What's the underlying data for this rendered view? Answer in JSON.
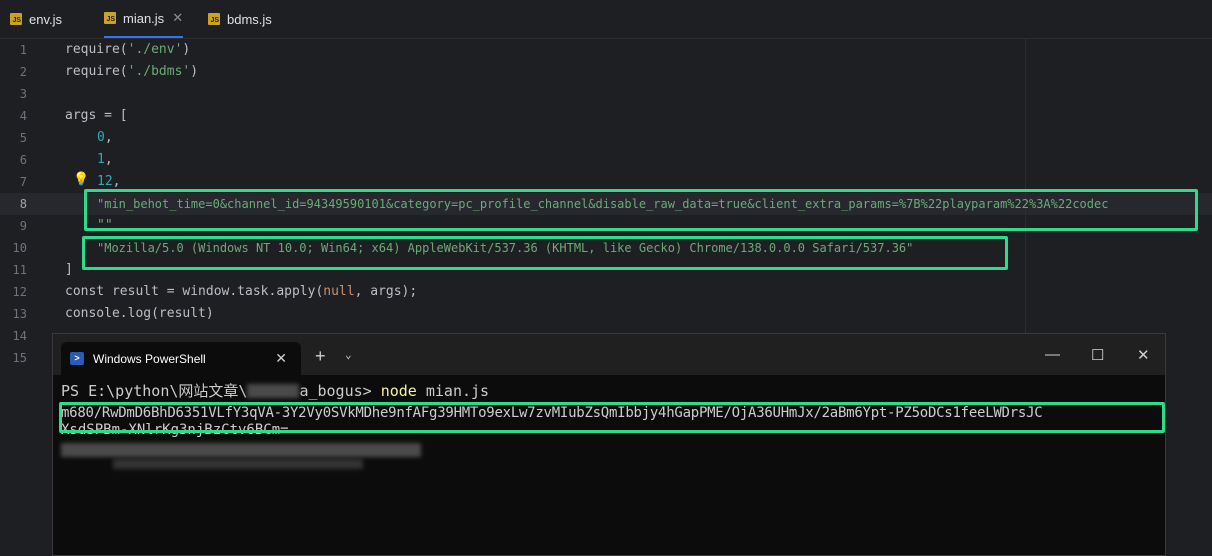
{
  "tabs": [
    {
      "label": "env.js",
      "active": false
    },
    {
      "label": "mian.js",
      "active": true,
      "close": "✕"
    },
    {
      "label": "bdms.js",
      "active": false
    }
  ],
  "icons": {
    "file_icon": "js-file-icon",
    "bulb": "lightbulb-icon",
    "terminal": "powershell-icon"
  },
  "colors": {
    "highlight_box": "#2ddb8a",
    "string": "#6aab73",
    "number": "#2aacb8",
    "keyword": "#cf8e6d",
    "tab_accent": "#3574f0"
  },
  "editor": {
    "line_numbers": [
      "1",
      "2",
      "3",
      "4",
      "5",
      "6",
      "7",
      "8",
      "9",
      "10",
      "11",
      "12",
      "13",
      "14",
      "15"
    ],
    "current_line": "8",
    "lines": {
      "l1_a": "require(",
      "l1_s": "'./env'",
      "l1_b": ")",
      "l2_a": "require(",
      "l2_s": "'./bdms'",
      "l2_b": ")",
      "l4": "args = [",
      "l5": "0",
      "l6": "1",
      "l7": "12",
      "l8": "\"min_behot_time=0&channel_id=94349590101&category=pc_profile_channel&disable_raw_data=true&client_extra_params=%7B%22playparam%22%3A%22codec",
      "l9": "\"\"",
      "l10": "\"Mozilla/5.0 (Windows NT 10.0; Win64; x64) AppleWebKit/537.36 (KHTML, like Gecko) Chrome/138.0.0.0 Safari/537.36\"",
      "l11": "]",
      "l12_a": "const result = window.task.apply(",
      "l12_null": "null",
      "l12_b": ", args);",
      "l13": "console.log(result)"
    }
  },
  "terminal": {
    "tab_title": "Windows PowerShell",
    "tab_close": "✕",
    "new_tab": "+",
    "dropdown": "⌄",
    "minimize": "—",
    "maximize": "☐",
    "close": "✕",
    "prompt_prefix": "PS E:\\python\\网站文章\\",
    "prompt_suffix": "a_bogus>",
    "command": "node",
    "command_arg": "mian.js",
    "output_line1": "m680/RwDmD6BhD6351VLfY3qVA-3Y2Vy0SVkMDhe9nfAFg39HMTo9exLw7zvMIubZsQmIbbjy4hGapPME/OjA36UHmJx/2aBm6Ypt-PZ5oDCs1feeLWDrsJC",
    "output_line2": "XsdSPBm-XNlrKg3njBzCtv6BCm="
  }
}
